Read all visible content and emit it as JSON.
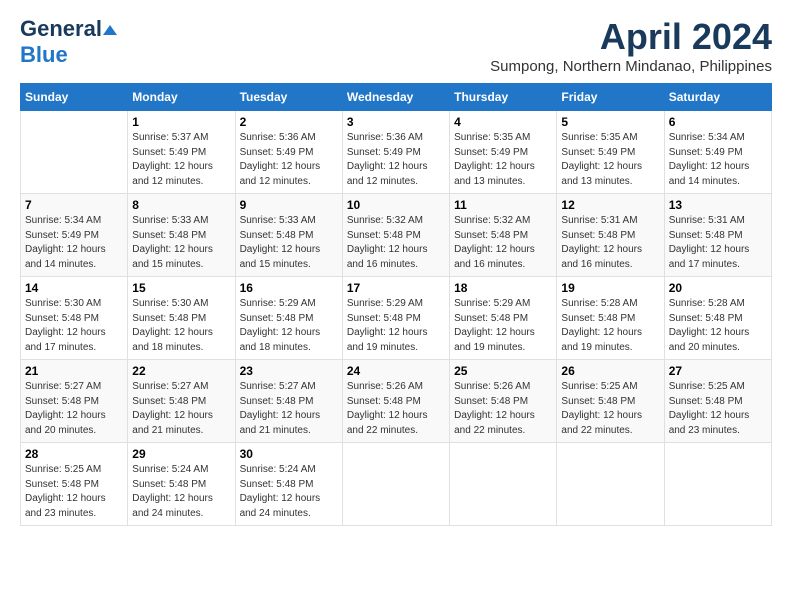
{
  "header": {
    "logo_general": "General",
    "logo_blue": "Blue",
    "month_title": "April 2024",
    "location": "Sumpong, Northern Mindanao, Philippines"
  },
  "weekdays": [
    "Sunday",
    "Monday",
    "Tuesday",
    "Wednesday",
    "Thursday",
    "Friday",
    "Saturday"
  ],
  "weeks": [
    [
      {
        "day": "",
        "sunrise": "",
        "sunset": "",
        "daylight": ""
      },
      {
        "day": "1",
        "sunrise": "Sunrise: 5:37 AM",
        "sunset": "Sunset: 5:49 PM",
        "daylight": "Daylight: 12 hours and 12 minutes."
      },
      {
        "day": "2",
        "sunrise": "Sunrise: 5:36 AM",
        "sunset": "Sunset: 5:49 PM",
        "daylight": "Daylight: 12 hours and 12 minutes."
      },
      {
        "day": "3",
        "sunrise": "Sunrise: 5:36 AM",
        "sunset": "Sunset: 5:49 PM",
        "daylight": "Daylight: 12 hours and 12 minutes."
      },
      {
        "day": "4",
        "sunrise": "Sunrise: 5:35 AM",
        "sunset": "Sunset: 5:49 PM",
        "daylight": "Daylight: 12 hours and 13 minutes."
      },
      {
        "day": "5",
        "sunrise": "Sunrise: 5:35 AM",
        "sunset": "Sunset: 5:49 PM",
        "daylight": "Daylight: 12 hours and 13 minutes."
      },
      {
        "day": "6",
        "sunrise": "Sunrise: 5:34 AM",
        "sunset": "Sunset: 5:49 PM",
        "daylight": "Daylight: 12 hours and 14 minutes."
      }
    ],
    [
      {
        "day": "7",
        "sunrise": "Sunrise: 5:34 AM",
        "sunset": "Sunset: 5:49 PM",
        "daylight": "Daylight: 12 hours and 14 minutes."
      },
      {
        "day": "8",
        "sunrise": "Sunrise: 5:33 AM",
        "sunset": "Sunset: 5:48 PM",
        "daylight": "Daylight: 12 hours and 15 minutes."
      },
      {
        "day": "9",
        "sunrise": "Sunrise: 5:33 AM",
        "sunset": "Sunset: 5:48 PM",
        "daylight": "Daylight: 12 hours and 15 minutes."
      },
      {
        "day": "10",
        "sunrise": "Sunrise: 5:32 AM",
        "sunset": "Sunset: 5:48 PM",
        "daylight": "Daylight: 12 hours and 16 minutes."
      },
      {
        "day": "11",
        "sunrise": "Sunrise: 5:32 AM",
        "sunset": "Sunset: 5:48 PM",
        "daylight": "Daylight: 12 hours and 16 minutes."
      },
      {
        "day": "12",
        "sunrise": "Sunrise: 5:31 AM",
        "sunset": "Sunset: 5:48 PM",
        "daylight": "Daylight: 12 hours and 16 minutes."
      },
      {
        "day": "13",
        "sunrise": "Sunrise: 5:31 AM",
        "sunset": "Sunset: 5:48 PM",
        "daylight": "Daylight: 12 hours and 17 minutes."
      }
    ],
    [
      {
        "day": "14",
        "sunrise": "Sunrise: 5:30 AM",
        "sunset": "Sunset: 5:48 PM",
        "daylight": "Daylight: 12 hours and 17 minutes."
      },
      {
        "day": "15",
        "sunrise": "Sunrise: 5:30 AM",
        "sunset": "Sunset: 5:48 PM",
        "daylight": "Daylight: 12 hours and 18 minutes."
      },
      {
        "day": "16",
        "sunrise": "Sunrise: 5:29 AM",
        "sunset": "Sunset: 5:48 PM",
        "daylight": "Daylight: 12 hours and 18 minutes."
      },
      {
        "day": "17",
        "sunrise": "Sunrise: 5:29 AM",
        "sunset": "Sunset: 5:48 PM",
        "daylight": "Daylight: 12 hours and 19 minutes."
      },
      {
        "day": "18",
        "sunrise": "Sunrise: 5:29 AM",
        "sunset": "Sunset: 5:48 PM",
        "daylight": "Daylight: 12 hours and 19 minutes."
      },
      {
        "day": "19",
        "sunrise": "Sunrise: 5:28 AM",
        "sunset": "Sunset: 5:48 PM",
        "daylight": "Daylight: 12 hours and 19 minutes."
      },
      {
        "day": "20",
        "sunrise": "Sunrise: 5:28 AM",
        "sunset": "Sunset: 5:48 PM",
        "daylight": "Daylight: 12 hours and 20 minutes."
      }
    ],
    [
      {
        "day": "21",
        "sunrise": "Sunrise: 5:27 AM",
        "sunset": "Sunset: 5:48 PM",
        "daylight": "Daylight: 12 hours and 20 minutes."
      },
      {
        "day": "22",
        "sunrise": "Sunrise: 5:27 AM",
        "sunset": "Sunset: 5:48 PM",
        "daylight": "Daylight: 12 hours and 21 minutes."
      },
      {
        "day": "23",
        "sunrise": "Sunrise: 5:27 AM",
        "sunset": "Sunset: 5:48 PM",
        "daylight": "Daylight: 12 hours and 21 minutes."
      },
      {
        "day": "24",
        "sunrise": "Sunrise: 5:26 AM",
        "sunset": "Sunset: 5:48 PM",
        "daylight": "Daylight: 12 hours and 22 minutes."
      },
      {
        "day": "25",
        "sunrise": "Sunrise: 5:26 AM",
        "sunset": "Sunset: 5:48 PM",
        "daylight": "Daylight: 12 hours and 22 minutes."
      },
      {
        "day": "26",
        "sunrise": "Sunrise: 5:25 AM",
        "sunset": "Sunset: 5:48 PM",
        "daylight": "Daylight: 12 hours and 22 minutes."
      },
      {
        "day": "27",
        "sunrise": "Sunrise: 5:25 AM",
        "sunset": "Sunset: 5:48 PM",
        "daylight": "Daylight: 12 hours and 23 minutes."
      }
    ],
    [
      {
        "day": "28",
        "sunrise": "Sunrise: 5:25 AM",
        "sunset": "Sunset: 5:48 PM",
        "daylight": "Daylight: 12 hours and 23 minutes."
      },
      {
        "day": "29",
        "sunrise": "Sunrise: 5:24 AM",
        "sunset": "Sunset: 5:48 PM",
        "daylight": "Daylight: 12 hours and 24 minutes."
      },
      {
        "day": "30",
        "sunrise": "Sunrise: 5:24 AM",
        "sunset": "Sunset: 5:48 PM",
        "daylight": "Daylight: 12 hours and 24 minutes."
      },
      {
        "day": "",
        "sunrise": "",
        "sunset": "",
        "daylight": ""
      },
      {
        "day": "",
        "sunrise": "",
        "sunset": "",
        "daylight": ""
      },
      {
        "day": "",
        "sunrise": "",
        "sunset": "",
        "daylight": ""
      },
      {
        "day": "",
        "sunrise": "",
        "sunset": "",
        "daylight": ""
      }
    ]
  ]
}
